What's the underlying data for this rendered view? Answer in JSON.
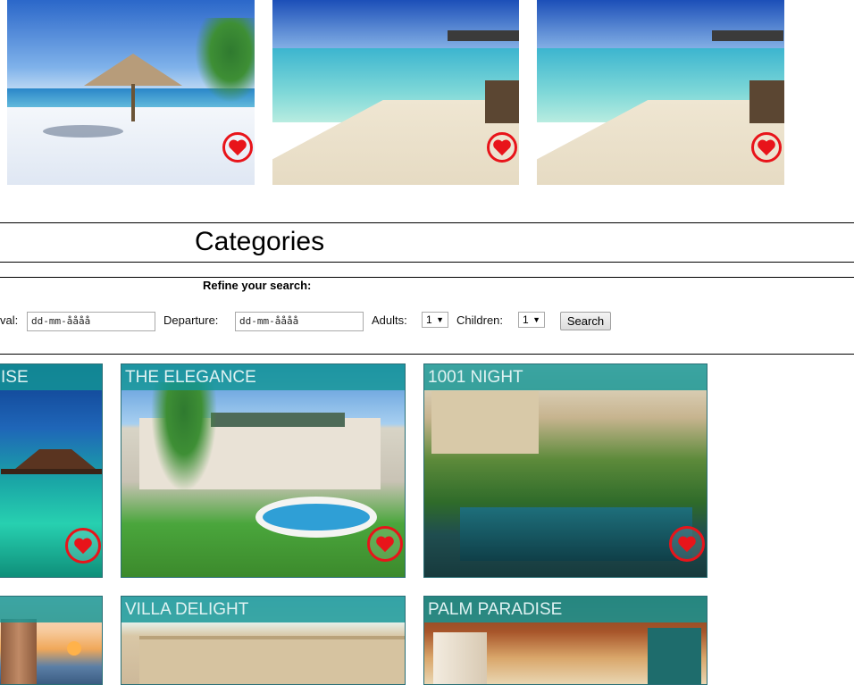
{
  "top_gallery": [
    {
      "name": "beach-umbrella-photo"
    },
    {
      "name": "overwater-beach-photo-1"
    },
    {
      "name": "overwater-beach-photo-2"
    }
  ],
  "categories": {
    "title": "Categories"
  },
  "refine": {
    "heading": "Refine your search:",
    "arrival_label": "val:",
    "arrival_value": "dd-mm-åååå",
    "departure_label": "Departure:",
    "departure_value": "dd-mm-åååå",
    "adults_label": "Adults:",
    "adults_value": "1",
    "children_label": "Children:",
    "children_value": "1",
    "search_label": "Search"
  },
  "cards_row1": [
    {
      "title": "ISE"
    },
    {
      "title": "THE ELEGANCE"
    },
    {
      "title": "1001 NIGHT"
    }
  ],
  "cards_row2": [
    {
      "title": ""
    },
    {
      "title": "VILLA DELIGHT"
    },
    {
      "title": "PALM PARADISE"
    }
  ],
  "colors": {
    "favorite": "#e8141a",
    "card_band": "#149696"
  }
}
